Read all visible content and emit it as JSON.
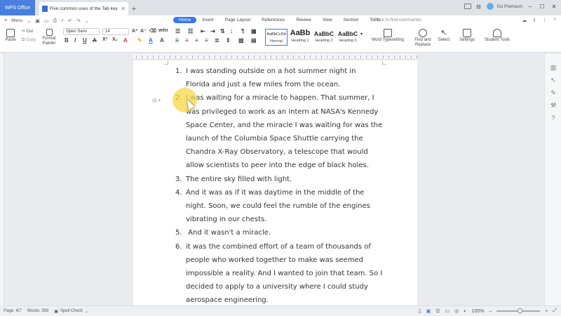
{
  "titlebar": {
    "app_tab": "WPS Office",
    "doc_tab": "Five common uses of the Tab key",
    "premium": "Go Premium"
  },
  "menubar": {
    "menu_label": "Menu",
    "tabs": [
      "Home",
      "Insert",
      "Page Layout",
      "References",
      "Review",
      "View",
      "Section",
      "Tools"
    ],
    "find_commands": "Click to find commands"
  },
  "ribbon": {
    "paste": "Paste",
    "cut": "Cut",
    "copy": "Copy",
    "format_painter": "Format Painter",
    "font_name": "Open Sans",
    "font_size": "14",
    "styles": [
      {
        "sample": "AaBbCcDd",
        "name": "Normal"
      },
      {
        "sample": "AaBb",
        "name": "Heading 1"
      },
      {
        "sample": "AaBbC",
        "name": "Heading 2"
      },
      {
        "sample": "AaBbC",
        "name": "Heading 3"
      }
    ],
    "word_typesetting": "Word Typesetting",
    "find_replace": "Find and Replace",
    "select": "Select",
    "settings": "Settings",
    "student_tools": "Student Tools"
  },
  "document": {
    "items": [
      {
        "num": "1.",
        "lines": [
          "I was standing outside on a hot summer night in",
          "Florida and just a few miles from the ocean."
        ]
      },
      {
        "num": "2.",
        "lines": [
          "I was waiting for a miracle to happen. That summer, I",
          "was privileged to work as an intern at NASA's Kennedy",
          "Space Center, and the miracle I was waiting for was the",
          "launch of the Columbia Space Shuttle carrying the",
          "Chandra X-Ray Observatory, a telescope that would",
          "allow scientists to peer into the edge of black holes."
        ]
      },
      {
        "num": "3.",
        "lines": [
          "The entire sky filled with light."
        ]
      },
      {
        "num": "4.",
        "lines": [
          "And it was as if it was daytime in the middle of the",
          "night. Soon, we could feel the rumble of the engines",
          "vibrating in our chests."
        ]
      },
      {
        "num": "5.",
        "lines": [
          " And it wasn't a miracle."
        ]
      },
      {
        "num": "6.",
        "lines": [
          "it was the combined effort of a team of thousands of",
          "people who worked together to make was seemed",
          "impossible a reality. And I wanted to join that team. So I",
          "decided to apply to a university where I could study",
          "aerospace engineering."
        ]
      }
    ]
  },
  "statusbar": {
    "page": "Page: 4/7",
    "words": "Words: 393",
    "spell_check": "Spell Check",
    "zoom": "100%"
  },
  "colors": {
    "accent": "#3a78e8",
    "highlight": "#f7d746"
  }
}
